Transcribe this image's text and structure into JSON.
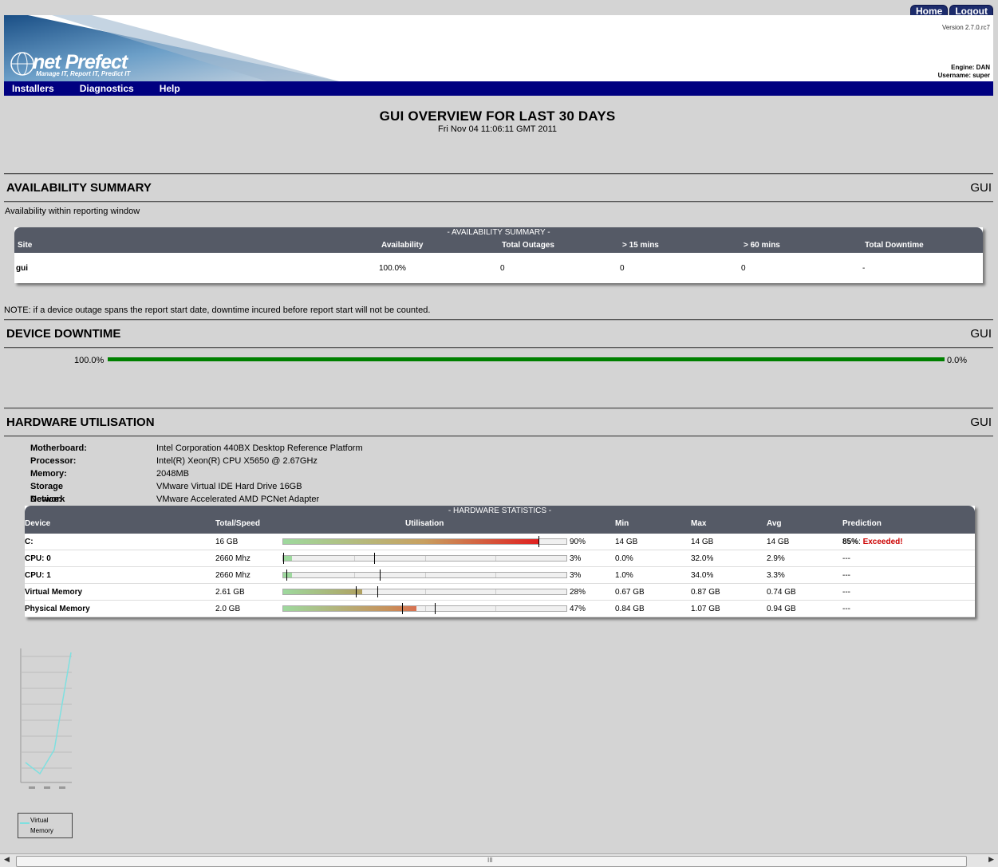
{
  "header": {
    "tabs": [
      "Home",
      "Logout"
    ],
    "logo_text": "net Prefect",
    "logo_tagline": "Manage IT, Report IT, Predict IT",
    "version": "Version 2.7.0.rc7",
    "engine": "Engine: DAN",
    "username": "Username: super"
  },
  "nav": {
    "items": [
      "Installers",
      "Diagnostics",
      "Help"
    ]
  },
  "report": {
    "title": "GUI OVERVIEW FOR LAST 30 DAYS",
    "date": "Fri Nov 04 11:06:11 GMT 2011"
  },
  "availability": {
    "heading": "AVAILABILITY SUMMARY",
    "group": "GUI",
    "intro": "Availability within reporting window",
    "caption": "- AVAILABILITY SUMMARY -",
    "columns": [
      "Site",
      "Availability",
      "Total Outages",
      "> 15 mins",
      "> 60 mins",
      "Total Downtime"
    ],
    "rows": [
      {
        "site": "gui",
        "availability": "100.0%",
        "outages": "0",
        "gt15": "0",
        "gt60": "0",
        "downtime": "-"
      }
    ],
    "note": "NOTE: if a device outage spans the report start date, downtime incured before report start will not be counted."
  },
  "downtime": {
    "heading": "DEVICE DOWNTIME",
    "group": "GUI",
    "up_label": "100.0%",
    "down_label": "0.0%",
    "up_fraction": 1.0
  },
  "hardware": {
    "heading": "HARDWARE UTILISATION",
    "group": "GUI",
    "specs": [
      {
        "label": "Motherboard:",
        "value": "Intel Corporation 440BX Desktop Reference Platform"
      },
      {
        "label": "Processor:",
        "value": "Intel(R) Xeon(R) CPU X5650 @ 2.67GHz"
      },
      {
        "label": "Memory:",
        "value": "2048MB"
      },
      {
        "label": "Storage Device:",
        "value": "VMware Virtual IDE Hard Drive 16GB"
      },
      {
        "label": "Network Interface Cards:",
        "value": "VMware Accelerated AMD PCNet Adapter"
      }
    ],
    "caption": "- HARDWARE STATISTICS -",
    "columns": [
      "Device",
      "Total/Speed",
      "Utilisation",
      "Min",
      "Max",
      "Avg",
      "Prediction"
    ],
    "rows": [
      {
        "device": "C:",
        "total": "16 GB",
        "util_label": "90%",
        "util": 0.9,
        "min_mark": 0.9,
        "max_mark": 0.9,
        "min": "14 GB",
        "max": "14 GB",
        "avg": "14 GB",
        "pred_pct": "85%",
        "pred_sep": ": ",
        "pred_status": "Exceeded!",
        "fill_color": "linear-gradient(to right,#9ed99e,#c8a060 55%,#e02020)"
      },
      {
        "device": "CPU: 0",
        "total": "2660 Mhz",
        "util_label": "3%",
        "util": 0.03,
        "min_mark": 0.0,
        "max_mark": 0.32,
        "min": "0.0%",
        "max": "32.0%",
        "avg": "2.9%",
        "pred_pct": "---",
        "pred_sep": "",
        "pred_status": "",
        "fill_color": "#9ed99e"
      },
      {
        "device": "CPU: 1",
        "total": "2660 Mhz",
        "util_label": "3%",
        "util": 0.03,
        "min_mark": 0.01,
        "max_mark": 0.34,
        "min": "1.0%",
        "max": "34.0%",
        "avg": "3.3%",
        "pred_pct": "---",
        "pred_sep": "",
        "pred_status": "",
        "fill_color": "#9ed99e"
      },
      {
        "device": "Virtual Memory",
        "total": "2.61 GB",
        "util_label": "28%",
        "util": 0.28,
        "min_mark": 0.257,
        "max_mark": 0.333,
        "min": "0.67 GB",
        "max": "0.87 GB",
        "avg": "0.74 GB",
        "pred_pct": "---",
        "pred_sep": "",
        "pred_status": "",
        "fill_color": "linear-gradient(to right,#9ed99e,#b0a060)"
      },
      {
        "device": "Physical Memory",
        "total": "2.0 GB",
        "util_label": "47%",
        "util": 0.47,
        "min_mark": 0.42,
        "max_mark": 0.535,
        "min": "0.84 GB",
        "max": "1.07 GB",
        "avg": "0.94 GB",
        "pred_pct": "---",
        "pred_sep": "",
        "pred_status": "",
        "fill_color": "linear-gradient(to right,#9ed99e,#c8905a 80%,#d87050)"
      }
    ]
  },
  "mini_chart": {
    "legend": [
      "Virtual",
      "Memory"
    ],
    "line_color": "#7fe0e0"
  },
  "scrollbar": {
    "grip": "III",
    "left": "◀",
    "right": "▶"
  }
}
